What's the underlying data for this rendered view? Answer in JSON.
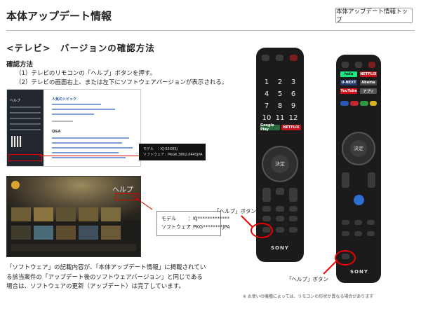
{
  "header": {
    "title": "本体アップデート情報",
    "top_button_label": "本体アップデート情報トップ"
  },
  "section": {
    "title": "<テレビ>　バージョンの確認方法"
  },
  "steps": {
    "title": "確認方法",
    "items": [
      "（1）テレビのリモコンの「ヘルプ」ボタンを押す。",
      "（2）テレビの画面右上、または左下にソフトウェアバージョンが表示される。"
    ]
  },
  "screenshot1": {
    "sidebar_title": "ヘルプ",
    "heading": "人気のトピック",
    "qa_label": "Q&A",
    "callout_lines": [
      "モデル　：KJ-55X85J",
      "ソフトウェア：PKG6.3862.0445JPA"
    ]
  },
  "screenshot2": {
    "help_label": "ヘルプ",
    "callout": {
      "model_label": "モデル",
      "model_value": "：KJ*************",
      "software_label": "ソフトウェア",
      "software_value": "：PKG********JPA"
    }
  },
  "note": "「ソフトウェア」の記載内容が、「本体アップデート情報」に掲載されている該当案件の「アップデート後のソフトウェアバージョン」と同じである場合は、ソフトウェアの更新（アップデート）は完了しています。",
  "remotes": {
    "help_button_label": "「ヘルプ」ボタン",
    "help_button_label_2": "「ヘルプ」ボタン",
    "brand": "SONY",
    "center_button": "決定",
    "footnote": "※ お使いの機種によっては、リモコンの形状が異なる場合があります",
    "numbers": [
      "1",
      "2",
      "3",
      "4",
      "5",
      "6",
      "7",
      "8",
      "9",
      "10",
      "11",
      "12"
    ],
    "services_left": [
      "Google Play",
      "NETFLIX"
    ],
    "services_right": [
      "hulu",
      "NETFLIX",
      "U-NEXT",
      "Abema",
      "YouTube",
      "アプリ"
    ]
  },
  "colors": {
    "accent_red": "#dd0000",
    "remote_body": "#1b1b1b"
  }
}
